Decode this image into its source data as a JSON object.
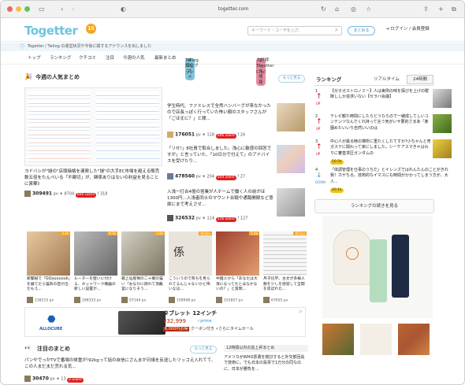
{
  "browser": {
    "url": "togetter.com"
  },
  "header": {
    "logo": "Togetter",
    "logo_badge": "15",
    "search_placeholder": "キーワード・ユーザを入力",
    "search_button": "まとめる",
    "login": "ログイン / 会員登録"
  },
  "notice": "Togetter / Twilog の運営状況や今後に関するアナウンスを出しました",
  "nav": {
    "items": [
      "トップ",
      "ランキング",
      "クチコミ",
      "注目",
      "今週の人気",
      "最新まとめ"
    ],
    "pill1": "オススメ",
    "pill1_text": "Twilog課金プラン",
    "pill2": "エンタ情報",
    "pill2_text": "大好評Togetter Clip!"
  },
  "popular": {
    "title": "今週の人気まとめ",
    "more": "もっと見る",
    "featured": {
      "text": "ヨドバシが\"謎の\"店頭価格を連発した\"謎\"の大手EC市場を越える販売数五倍をたんぺいる「不親切」が、関係ありはないの利益を見ることに賞華》",
      "views": "309491",
      "views_unit": "pv",
      "users_count": "8704",
      "users_badge": "600 users",
      "likes": "318"
    },
    "items": [
      {
        "text": "学生時代、ファミレスで全然ハンバーグが来なかったので店長っぽく行っていた怖い顔のスタッフさんが「ごほ丈に？」と聞...",
        "views": "176051",
        "users_count": "118",
        "users_badge": "266 users",
        "likes": "24"
      },
      {
        "text": "「リせ!」8社員で取合しました。浅心に敏感の回答ですが」と言っていた、「10日分で付えて」のアドバイスを受けたり...",
        "views": "478560",
        "users_count": "204",
        "users_badge": "204 users",
        "likes": "27"
      },
      {
        "text": "入浅一打合4億の営業が人ホームで働く人の前がほ1300円...入浅者同士のマウント合戦や通路開閉など意欲にまで考えさせ...",
        "views": "326532",
        "users_count": "114",
        "users_badge": "216 users",
        "likes": "127"
      }
    ]
  },
  "grid": [
    {
      "caption": "新聞紙で「GQuuuuuuk」を綴てたら猫系の首が出たもえ...",
      "views": "138215",
      "badge": "4.4k"
    },
    {
      "caption": "ルーターを壁いに付ける、ネットワーク機器の新しい設置が...",
      "views": "298333",
      "badge": "6.1k"
    },
    {
      "caption": "箱上仙崖禅の二十郷の猫い「おなかに顔れて頂戴室になりそう...",
      "views": "97144",
      "badge": "1.6k"
    },
    {
      "caption": "こういうので育ちを見られてるんじゃないかと怖いなは...",
      "views": "109948",
      "badge": "814pv"
    },
    {
      "caption": "中国人から「あなたは大湊になってたとはなかないの？」と質問...",
      "views": "101857",
      "badge": "1.4k"
    },
    {
      "caption": "月子化学、主文が多様人数を少しを感覚して全開を収ぼれた...",
      "views": "67655",
      "badge": "817pv"
    }
  ],
  "ad": {
    "logo": "ALLOCUBE",
    "title": "タブレット 12インチ",
    "price": "¥32,999",
    "price_note": "✓prime",
    "coupon": "6,000円お得",
    "coupon_text": "クーポン付き ⚡さらにタイムセール"
  },
  "attention": {
    "title": "注目のまとめ",
    "more": "もっと見る",
    "text": "パンやでっかTVで番場の体重が!92kgって話の自信にさんまが日焼を反送したツッコえ入れてて、この人まだまだ売れる気...",
    "views": "30470",
    "users_count": "13",
    "users_badge": "2 users"
  },
  "attention_side": {
    "title": "12時間以内の急上昇まとめ",
    "text": "アメリカがWHO票選を検討すると外交部回長で技術に。でも日本の投票で1万分の同なのに、日本が勝負を..."
  },
  "ranking": {
    "title": "ランキング",
    "tab_realtime": "リアルタイム",
    "tab_24h": "24時間",
    "more_button": "ランキングの続きを見る",
    "items": [
      {
        "rank": "1",
        "dir": "UP",
        "text": "【分子ガストロノミー】人は実例の味を探びを上げの曖昧ししか追求いない【セラバ会議】"
      },
      {
        "rank": "2",
        "dir": "UP",
        "text": "テレビ観た時間にしたらどうならので一緒成してしいコンテンツなんでくれ持って言う気がいサ要的さまあ「楽園めたいいり自然いいのは"
      },
      {
        "rank": "3",
        "dir": "UP",
        "text": "中心人が最る時の場所に重たくしたてすか?小ちゃんと育ガステに関わって家にしました。シーケアスマきゃはわりに審査求区ガンダムの",
        "badge": "50.5k"
      },
      {
        "rank": "4",
        "dir": "DOWN",
        "text": "「体調管理を仕事のうちだ」とイレンズではれんたんのことがきれ我！カゲちる。技術的なイマスにも時間がかかってしまう方が、大人...",
        "badge": "20.1k"
      }
    ]
  }
}
